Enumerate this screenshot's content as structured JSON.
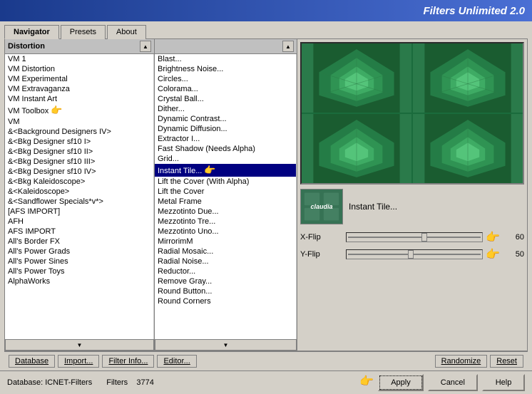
{
  "app": {
    "title": "Filters Unlimited 2.0"
  },
  "tabs": [
    {
      "label": "Navigator",
      "active": true
    },
    {
      "label": "Presets",
      "active": false
    },
    {
      "label": "About",
      "active": false
    }
  ],
  "categories": [
    {
      "label": "VM 1",
      "selected": false
    },
    {
      "label": "VM Distortion",
      "selected": false
    },
    {
      "label": "VM Experimental",
      "selected": false
    },
    {
      "label": "VM Extravaganza",
      "selected": false
    },
    {
      "label": "VM Instant Art",
      "selected": false
    },
    {
      "label": "VM Toolbox",
      "selected": false
    },
    {
      "label": "VM",
      "selected": false
    },
    {
      "label": "&<Background Designers IV>",
      "selected": false
    },
    {
      "label": "&<Bkg Designer sf10 I>",
      "selected": false
    },
    {
      "label": "&<Bkg Designer sf10 II>",
      "selected": false
    },
    {
      "label": "&<Bkg Designer sf10 III>",
      "selected": false
    },
    {
      "label": "&<Bkg Designer sf10 IV>",
      "selected": false
    },
    {
      "label": "&<Bkg Kaleidoscope>",
      "selected": false
    },
    {
      "label": "&<Kaleidoscope>",
      "selected": false
    },
    {
      "label": "&<Sandflower Specials*v*>",
      "selected": false
    },
    {
      "label": "[AFS IMPORT]",
      "selected": false
    },
    {
      "label": "AFH",
      "selected": false
    },
    {
      "label": "AFS IMPORT",
      "selected": false
    },
    {
      "label": "All's Border FX",
      "selected": false
    },
    {
      "label": "All's Power Grads",
      "selected": false
    },
    {
      "label": "All's Power Sines",
      "selected": false
    },
    {
      "label": "All's Power Toys",
      "selected": false
    },
    {
      "label": "AlphaWorks",
      "selected": false
    }
  ],
  "category_header": "Distortion",
  "filters": [
    {
      "label": "Blast...",
      "selected": false
    },
    {
      "label": "Brightness Noise...",
      "selected": false
    },
    {
      "label": "Circles...",
      "selected": false
    },
    {
      "label": "Colorama...",
      "selected": false
    },
    {
      "label": "Crystal Ball...",
      "selected": false
    },
    {
      "label": "Dither...",
      "selected": false
    },
    {
      "label": "Dynamic Contrast...",
      "selected": false
    },
    {
      "label": "Dynamic Diffusion...",
      "selected": false
    },
    {
      "label": "Extractor I...",
      "selected": false
    },
    {
      "label": "Fast Shadow (Needs Alpha)",
      "selected": false
    },
    {
      "label": "Grid...",
      "selected": false
    },
    {
      "label": "Instant Tile...",
      "selected": true
    },
    {
      "label": "Lift the Cover (With Alpha)",
      "selected": false
    },
    {
      "label": "Lift the Cover",
      "selected": false
    },
    {
      "label": "Metal Frame",
      "selected": false
    },
    {
      "label": "Mezzotinto Due...",
      "selected": false
    },
    {
      "label": "Mezzotinto Tre...",
      "selected": false
    },
    {
      "label": "Mezzotinto Uno...",
      "selected": false
    },
    {
      "label": "MirrorimM",
      "selected": false
    },
    {
      "label": "Radial Mosaic...",
      "selected": false
    },
    {
      "label": "Radial Noise...",
      "selected": false
    },
    {
      "label": "Reductor...",
      "selected": false
    },
    {
      "label": "Remove Gray...",
      "selected": false
    },
    {
      "label": "Round Button...",
      "selected": false
    },
    {
      "label": "Round Corners",
      "selected": false
    }
  ],
  "filter_name": "Instant Tile...",
  "params": [
    {
      "label": "X-Flip",
      "value": 60,
      "percent": 60
    },
    {
      "label": "Y-Flip",
      "value": 50,
      "percent": 50
    }
  ],
  "bottom_toolbar": {
    "database": "Database",
    "import": "Import...",
    "filter_info": "Filter Info...",
    "editor": "Editor...",
    "randomize": "Randomize",
    "reset": "Reset"
  },
  "status": {
    "database_label": "Database:",
    "database_value": "ICNET-Filters",
    "filters_label": "Filters",
    "filters_value": "3774"
  },
  "action_buttons": {
    "apply": "Apply",
    "cancel": "Cancel",
    "help": "Help"
  },
  "thumb_text": "claudia"
}
